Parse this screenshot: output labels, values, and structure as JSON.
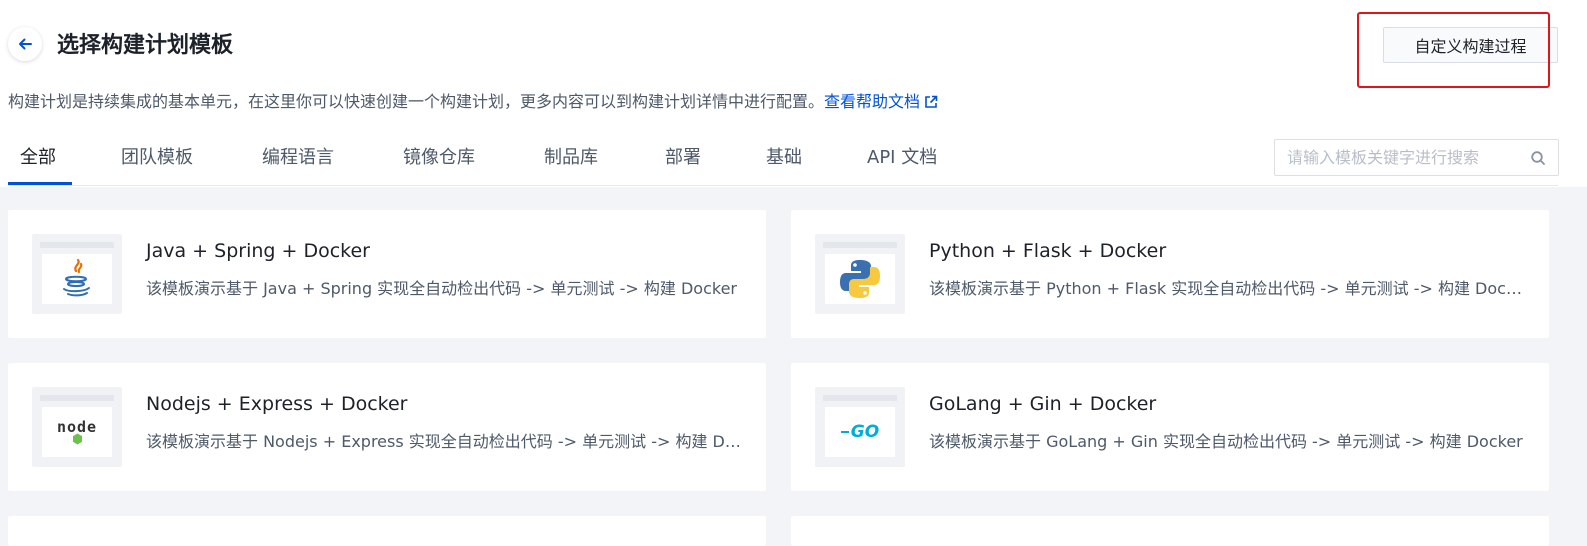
{
  "header": {
    "title": "选择构建计划模板",
    "custom_button": "自定义构建过程"
  },
  "description": {
    "text": "构建计划是持续集成的基本单元，在这里你可以快速创建一个构建计划，更多内容可以到构建计划详情中进行配置。",
    "help_link": "查看帮助文档"
  },
  "tabs": [
    {
      "label": "全部",
      "active": true
    },
    {
      "label": "团队模板"
    },
    {
      "label": "编程语言"
    },
    {
      "label": "镜像仓库"
    },
    {
      "label": "制品库"
    },
    {
      "label": "部署"
    },
    {
      "label": "基础"
    },
    {
      "label": "API 文档"
    }
  ],
  "search": {
    "placeholder": "请输入模板关键字进行搜索"
  },
  "templates": [
    {
      "title": "Java + Spring + Docker",
      "description": "该模板演示基于 Java + Spring 实现全自动检出代码 -> 单元测试 -> 构建 Docker",
      "icon": "java-icon"
    },
    {
      "title": "Python + Flask + Docker",
      "description": "该模板演示基于 Python + Flask 实现全自动检出代码 -> 单元测试 -> 构建 Docker",
      "icon": "python-icon"
    },
    {
      "title": "Nodejs + Express + Docker",
      "description": "该模板演示基于 Nodejs + Express 实现全自动检出代码 -> 单元测试 -> 构建 Docker",
      "icon": "nodejs-icon"
    },
    {
      "title": "GoLang + Gin + Docker",
      "description": "该模板演示基于 GoLang + Gin 实现全自动检出代码 -> 单元测试 -> 构建 Docker",
      "icon": "golang-icon"
    }
  ],
  "logo_text": {
    "node": "node",
    "go": "GO"
  },
  "colors": {
    "primary": "#0052d9",
    "highlight": "#e0141c",
    "background": "#f3f4f7"
  }
}
